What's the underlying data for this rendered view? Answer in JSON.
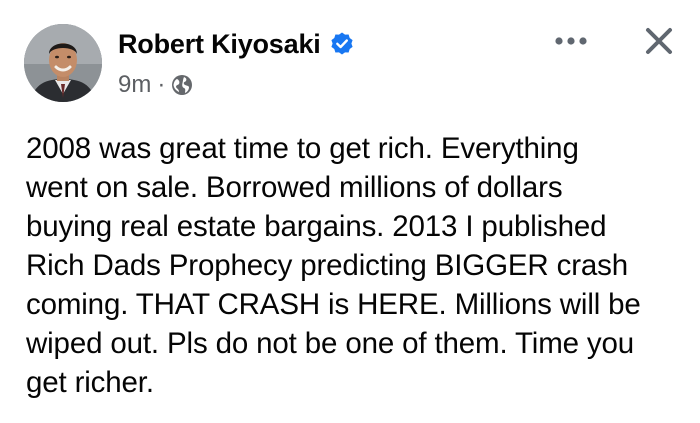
{
  "post": {
    "author": {
      "name": "Robert Kiyosaki",
      "verified_icon": "verified-badge-icon",
      "avatar_icon": "profile-photo"
    },
    "meta": {
      "time": "9m",
      "separator": "·",
      "audience_icon": "globe-icon"
    },
    "actions": {
      "more_icon": "more-options-icon",
      "close_icon": "close-icon"
    },
    "body_lines": [
      "2008 was great time to get rich. Everything",
      "went on sale. Borrowed millions of dollars",
      "buying real estate bargains. 2013 I published",
      "Rich Dads Prophecy predicting BIGGER crash",
      "coming. THAT CRASH is HERE. Millions will be",
      "wiped out. Pls do not be one of them. Time you",
      "get richer."
    ]
  },
  "colors": {
    "text": "#050505",
    "secondary_text": "#5c5f63",
    "verified_blue": "#1877f2",
    "icon_gray": "#606770",
    "background": "#ffffff"
  }
}
